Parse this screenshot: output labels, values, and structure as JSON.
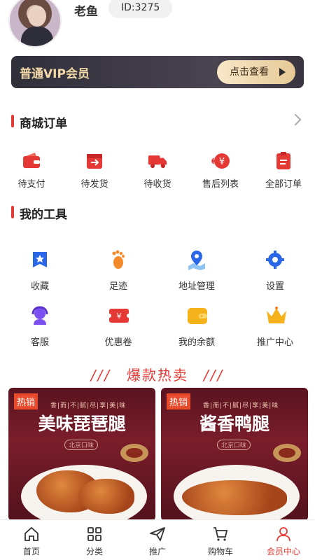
{
  "user": {
    "name": "老鱼",
    "id_label": "ID:3275"
  },
  "vip": {
    "title": "普通VIP会员",
    "button": "点击查看"
  },
  "orders": {
    "title": "商城订单",
    "items": [
      {
        "label": "待支付",
        "icon": "wallet-icon"
      },
      {
        "label": "待发货",
        "icon": "box-out-icon"
      },
      {
        "label": "待收货",
        "icon": "truck-icon"
      },
      {
        "label": "售后列表",
        "icon": "yen-refund-icon"
      },
      {
        "label": "全部订单",
        "icon": "clipboard-icon"
      }
    ]
  },
  "tools": {
    "title": "我的工具",
    "items": [
      {
        "label": "收藏",
        "icon": "bookmark-star-icon"
      },
      {
        "label": "足迹",
        "icon": "footprint-icon"
      },
      {
        "label": "地址管理",
        "icon": "map-pin-icon"
      },
      {
        "label": "设置",
        "icon": "gear-icon"
      },
      {
        "label": "客服",
        "icon": "headset-icon"
      },
      {
        "label": "优惠卷",
        "icon": "coupon-icon"
      },
      {
        "label": "我的余额",
        "icon": "wallet-balance-icon"
      },
      {
        "label": "推广中心",
        "icon": "crown-icon"
      }
    ]
  },
  "hot": {
    "slash_left": "///",
    "title": "爆款热卖",
    "slash_right": "///",
    "products": [
      {
        "tag": "热销",
        "slogan": "香|而|不|腻|尽|享|美|味",
        "name": "美味琵琶腿",
        "sub": "北京口味"
      },
      {
        "tag": "热销",
        "slogan": "香|而|不|腻|尽|享|美|味",
        "name": "酱香鸭腿",
        "sub": "北京口味"
      }
    ]
  },
  "tabbar": {
    "items": [
      {
        "label": "首页",
        "icon": "home-icon"
      },
      {
        "label": "分类",
        "icon": "grid-icon"
      },
      {
        "label": "推广",
        "icon": "paper-plane-icon"
      },
      {
        "label": "购物车",
        "icon": "cart-icon"
      },
      {
        "label": "会员中心",
        "icon": "user-icon",
        "active": true
      }
    ]
  },
  "colors": {
    "accent": "#e53935",
    "vip_bg": "#3a3440",
    "vip_text": "#f3d8a8"
  }
}
